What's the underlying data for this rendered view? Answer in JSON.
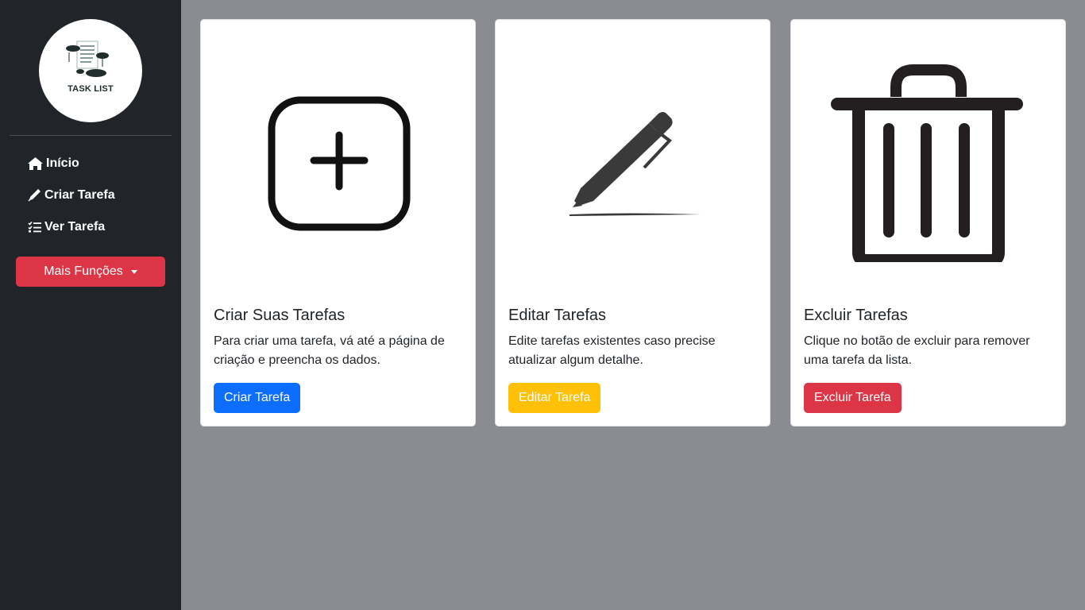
{
  "sidebar": {
    "logo_text": "TASK LIST",
    "nav": [
      {
        "label": "Início",
        "icon": "home-icon"
      },
      {
        "label": "Criar Tarefa",
        "icon": "pen-icon"
      },
      {
        "label": "Ver Tarefa",
        "icon": "list-check-icon"
      }
    ],
    "dropdown_label": "Mais Funções"
  },
  "cards": [
    {
      "title": "Criar Suas Tarefas",
      "text": "Para criar uma tarefa, vá até a página de criação e preencha os dados.",
      "button": "Criar Tarefa",
      "button_color": "#0d6efd",
      "icon": "plus-square-icon"
    },
    {
      "title": "Editar Tarefas",
      "text": "Edite tarefas existentes caso precise atualizar algum detalhe.",
      "button": "Editar Tarefa",
      "button_color": "#ffc107",
      "icon": "pen-icon"
    },
    {
      "title": "Excluir Tarefas",
      "text": "Clique no botão de excluir para remover uma tarefa da lista.",
      "button": "Excluir Tarefa",
      "button_color": "#dc3545",
      "icon": "trash-icon"
    }
  ],
  "colors": {
    "sidebar_bg": "#212429",
    "page_bg": "#8a8c91",
    "danger": "#dc3545",
    "primary": "#0d6efd",
    "warning": "#ffc107"
  }
}
